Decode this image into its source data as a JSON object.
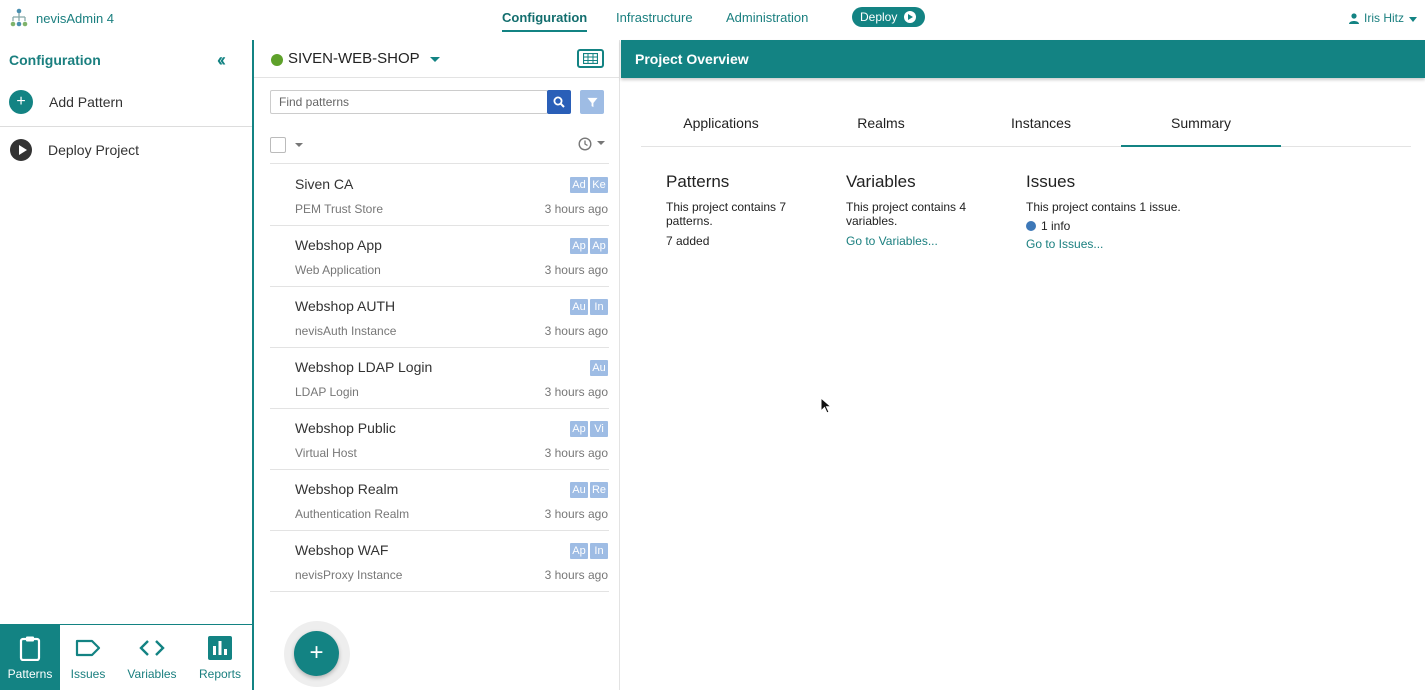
{
  "app": {
    "name": "nevisAdmin 4"
  },
  "nav": {
    "items": [
      {
        "label": "Configuration",
        "active": true
      },
      {
        "label": "Infrastructure",
        "active": false
      },
      {
        "label": "Administration",
        "active": false
      }
    ],
    "deploy_label": "Deploy",
    "user_name": "Iris Hitz"
  },
  "sidebar": {
    "title": "Configuration",
    "items": [
      {
        "label": "Add Pattern",
        "icon": "plus-circle-icon",
        "color": "#138383"
      },
      {
        "label": "Deploy Project",
        "icon": "play-circle-icon",
        "color": "#333333"
      }
    ],
    "bottom_tabs": [
      {
        "label": "Patterns",
        "icon": "clipboard-icon",
        "active": true
      },
      {
        "label": "Issues",
        "icon": "tag-icon",
        "active": false
      },
      {
        "label": "Variables",
        "icon": "code-icon",
        "active": false
      },
      {
        "label": "Reports",
        "icon": "bar-chart-icon",
        "active": false
      }
    ]
  },
  "project": {
    "name": "SIVEN-WEB-SHOP",
    "status_color": "#5ea12a"
  },
  "search": {
    "placeholder": "Find patterns"
  },
  "patterns": [
    {
      "name": "Siven CA",
      "type": "PEM Trust Store",
      "time": "3 hours ago",
      "tags": [
        "Ad",
        "Ke"
      ]
    },
    {
      "name": "Webshop App",
      "type": "Web Application",
      "time": "3 hours ago",
      "tags": [
        "Ap",
        "Ap"
      ]
    },
    {
      "name": "Webshop AUTH",
      "type": "nevisAuth Instance",
      "time": "3 hours ago",
      "tags": [
        "Au",
        "In"
      ]
    },
    {
      "name": "Webshop LDAP Login",
      "type": "LDAP Login",
      "time": "3 hours ago",
      "tags": [
        "Au"
      ]
    },
    {
      "name": "Webshop Public",
      "type": "Virtual Host",
      "time": "3 hours ago",
      "tags": [
        "Ap",
        "Vi"
      ]
    },
    {
      "name": "Webshop Realm",
      "type": "Authentication Realm",
      "time": "3 hours ago",
      "tags": [
        "Au",
        "Re"
      ]
    },
    {
      "name": "Webshop WAF",
      "type": "nevisProxy Instance",
      "time": "3 hours ago",
      "tags": [
        "Ap",
        "In"
      ]
    }
  ],
  "overview": {
    "title": "Project Overview",
    "tabs": [
      {
        "label": "Applications",
        "active": false
      },
      {
        "label": "Realms",
        "active": false
      },
      {
        "label": "Instances",
        "active": false
      },
      {
        "label": "Summary",
        "active": true
      }
    ],
    "patterns": {
      "heading": "Patterns",
      "text": "This project contains 7 patterns.",
      "added": "7 added"
    },
    "variables": {
      "heading": "Variables",
      "text": "This project contains 4 variables.",
      "link": "Go to Variables..."
    },
    "issues": {
      "heading": "Issues",
      "text": "This project contains 1 issue.",
      "info": "1 info",
      "link": "Go to Issues..."
    }
  },
  "colors": {
    "accent": "#138383",
    "tag": "#9ebce4",
    "search_button": "#2a5fb8",
    "info": "#3d78b8"
  }
}
